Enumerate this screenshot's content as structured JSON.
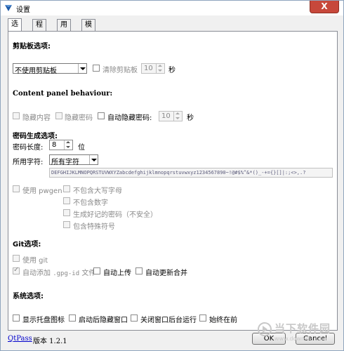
{
  "window": {
    "title": "设置",
    "close_label": "X"
  },
  "tabs": [
    {
      "label": "选项"
    },
    {
      "label": "程序"
    },
    {
      "label": "用户"
    },
    {
      "label": "模板"
    }
  ],
  "clipboard": {
    "heading": "剪贴板选项:",
    "mode_value": "不使用剪贴板",
    "clear_label": "清除剪贴板",
    "clear_seconds": "10",
    "seconds_unit": "秒"
  },
  "content_panel": {
    "heading": "Content panel behaviour:",
    "hide_content": "隐藏内容",
    "hide_password": "隐藏密码",
    "auto_hide_password": "自动隐藏密码:",
    "auto_hide_seconds": "10",
    "seconds_unit": "秒"
  },
  "password_gen": {
    "heading": "密码生成选项:",
    "length_label": "密码长度:",
    "length_value": "8",
    "length_unit": "位",
    "charset_label": "所用字符:",
    "charset_value": "所有字符",
    "charset_text": "DEFGHIJKLMNOPQRSTUVWXYZabcdefghijklmnopqrstuvwxyz1234567890~!@#$%^&*()_-+={}[]|:;<>,.?",
    "use_pwgen": "使用 pwgen",
    "no_uppercase": "不包含大写字母",
    "no_digits": "不包含数字",
    "memorable": "生成好记的密码（不安全）",
    "special_chars": "包含特殊符号"
  },
  "git": {
    "heading": "Git选项:",
    "use_git": "使用 git",
    "auto_add_prefix": "自动添加",
    "auto_add_gpgid": ".gpg-id",
    "auto_add_suffix": "文件",
    "auto_push": "自动上传",
    "auto_pull": "自动更新合并"
  },
  "system": {
    "heading": "系统选项:",
    "tray_icon": "显示托盘图标",
    "start_minimized": "启动后隐藏窗口",
    "hide_on_close": "关闭窗口后台运行",
    "always_on_top": "始终在前"
  },
  "footer": {
    "link": "QtPass",
    "version": "版本 1.2.1",
    "ok": "OK",
    "cancel": "Cancel"
  },
  "watermark": {
    "text": "当下软件园",
    "subtext": "www.downxia.com"
  },
  "colors": {
    "close_red": "#c7483b",
    "link_blue": "#0000cc",
    "disabled_gray": "#8a8a8a",
    "watermark": "#c8c8c8"
  }
}
